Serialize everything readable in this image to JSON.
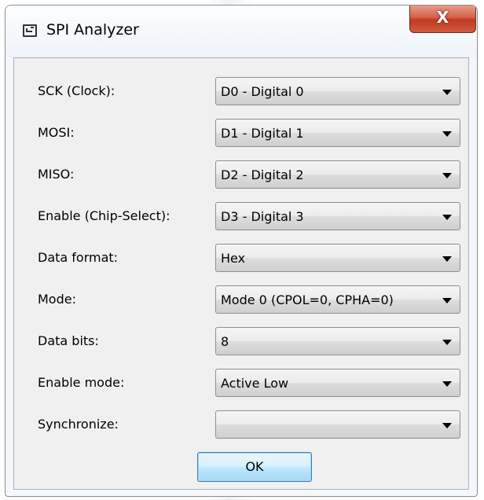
{
  "window": {
    "title": "SPI Analyzer",
    "close_label": "X"
  },
  "form": {
    "rows": [
      {
        "label": "SCK (Clock):",
        "value": "D0 - Digital 0"
      },
      {
        "label": "MOSI:",
        "value": "D1 - Digital 1"
      },
      {
        "label": "MISO:",
        "value": "D2 - Digital 2"
      },
      {
        "label": "Enable (Chip-Select):",
        "value": "D3 - Digital 3"
      },
      {
        "label": "Data format:",
        "value": "Hex"
      },
      {
        "label": "Mode:",
        "value": "Mode 0 (CPOL=0, CPHA=0)"
      },
      {
        "label": "Data bits:",
        "value": "8"
      },
      {
        "label": "Enable mode:",
        "value": "Active Low"
      },
      {
        "label": "Synchronize:",
        "value": ""
      }
    ],
    "ok_label": "OK"
  },
  "icons": {
    "window_icon": "window-icon",
    "dropdown_arrow": "chevron-down-icon"
  }
}
